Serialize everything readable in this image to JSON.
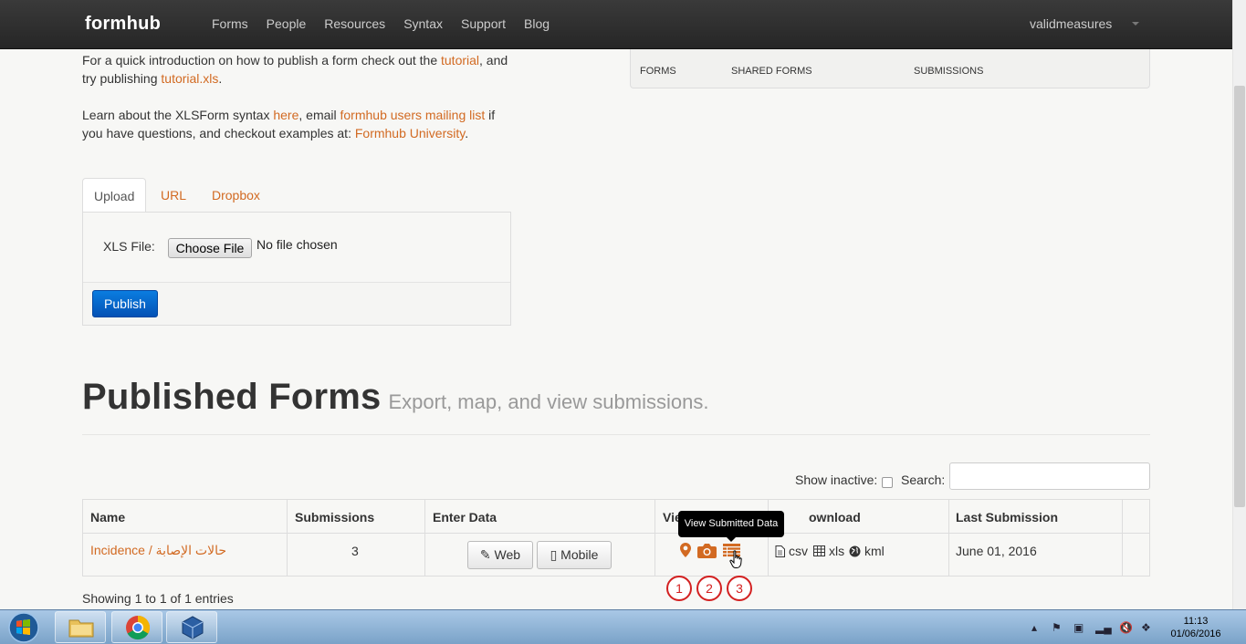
{
  "navbar": {
    "brand": "formhub",
    "links": [
      "Forms",
      "People",
      "Resources",
      "Syntax",
      "Support",
      "Blog"
    ],
    "user": "validmeasures"
  },
  "intro": {
    "p1_before": "For a quick introduction on how to publish a form check out the ",
    "p1_link1": "tutorial",
    "p1_mid": ", and try publishing ",
    "p1_link2": "tutorial.xls",
    "p1_after": ".",
    "p2_before": "Learn about the XLSForm syntax ",
    "p2_link1": "here",
    "p2_mid1": ", email ",
    "p2_link2": "formhub users mailing list",
    "p2_mid2": " if you have questions, and checkout examples at: ",
    "p2_link3": "Formhub University",
    "p2_after": "."
  },
  "right_panel": {
    "cols": [
      "FORMS",
      "SHARED FORMS",
      "SUBMISSIONS"
    ]
  },
  "upload": {
    "tabs": [
      "Upload",
      "URL",
      "Dropbox"
    ],
    "xls_label": "XLS File:",
    "choose_file": "Choose File",
    "no_file": "No file chosen",
    "publish": "Publish"
  },
  "published": {
    "title": "Published Forms",
    "subtitle": "Export, map, and view submissions."
  },
  "filters": {
    "show_inactive": "Show inactive:",
    "search": "Search:"
  },
  "table": {
    "headers": [
      "Name",
      "Submissions",
      "Enter Data",
      "View",
      "Download",
      "Last Submission"
    ],
    "row": {
      "name": "Incidence / حالات الإصابة",
      "submissions": "3",
      "web": "Web",
      "mobile": "Mobile",
      "csv": "csv",
      "xls": "xls",
      "kml": "kml",
      "last_submission": "June 01, 2016"
    },
    "view_header_visible": "Vie",
    "download_header_visible": "ownload",
    "tooltip": "View Submitted Data"
  },
  "callouts": [
    "1",
    "2",
    "3"
  ],
  "showing": "Showing 1 to 1 of 1 entries",
  "taskbar": {
    "time": "11:13",
    "date": "01/06/2016"
  },
  "colors": {
    "link": "#d26a22",
    "publish": "#0a64c8",
    "callout": "#d32020"
  }
}
